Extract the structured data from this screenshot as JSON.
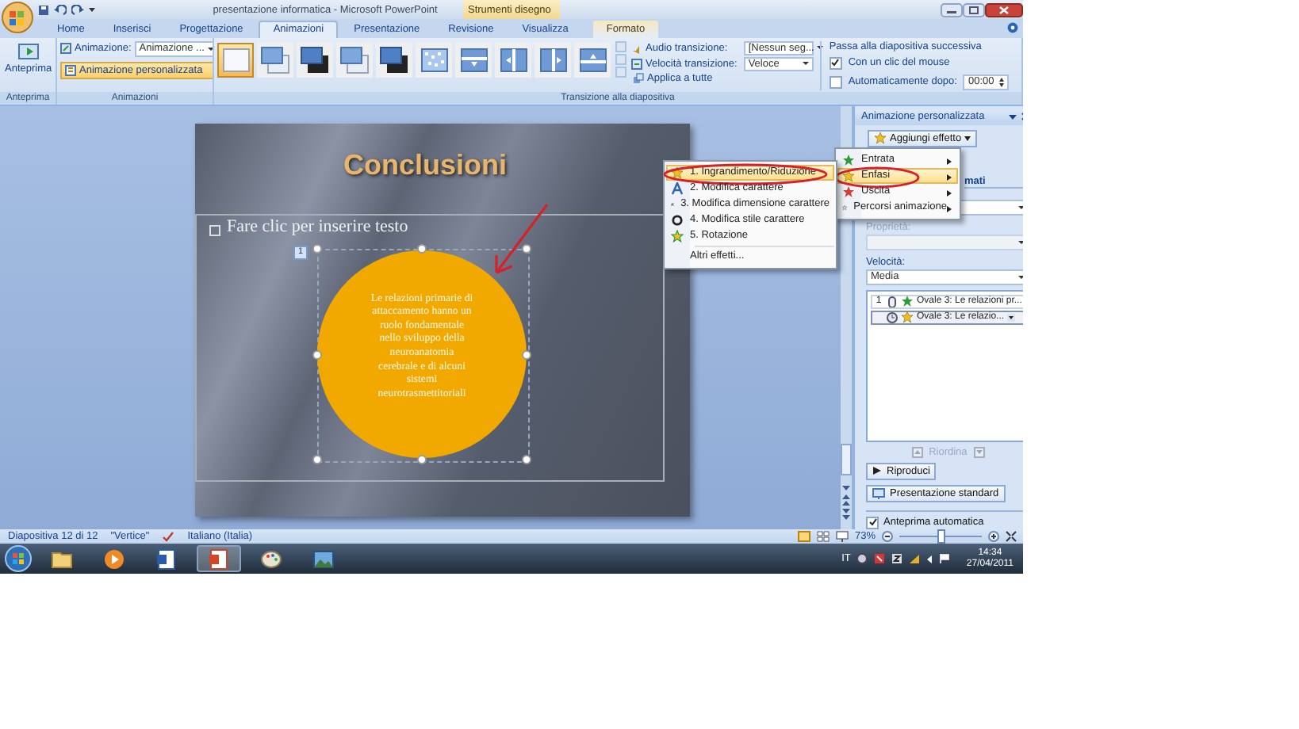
{
  "window": {
    "title": "presentazione informatica - Microsoft PowerPoint",
    "context_group": "Strumenti disegno"
  },
  "tabs": [
    {
      "label": "Home",
      "selected": false,
      "kind": "normal"
    },
    {
      "label": "Inserisci",
      "selected": false,
      "kind": "normal"
    },
    {
      "label": "Progettazione",
      "selected": false,
      "kind": "normal"
    },
    {
      "label": "Animazioni",
      "selected": true,
      "kind": "normal"
    },
    {
      "label": "Presentazione",
      "selected": false,
      "kind": "normal"
    },
    {
      "label": "Revisione",
      "selected": false,
      "kind": "normal"
    },
    {
      "label": "Visualizza",
      "selected": false,
      "kind": "normal"
    },
    {
      "label": "Formato",
      "selected": false,
      "kind": "context"
    }
  ],
  "ribbon": {
    "preview": {
      "button": "Anteprima",
      "group_label": "Anteprima"
    },
    "animations": {
      "animation_label": "Animazione:",
      "animation_value": "Animazione ...",
      "custom_button": {
        "label": "Animazione personalizzata",
        "selected": true
      },
      "group_label": "Animazioni"
    },
    "transitions": {
      "thumbnails": [
        {
          "kind": "none",
          "selected": true
        },
        {
          "kind": "fade",
          "selected": false
        },
        {
          "kind": "dark",
          "selected": false
        },
        {
          "kind": "fade",
          "selected": false
        },
        {
          "kind": "dark",
          "selected": false
        },
        {
          "kind": "dissolve",
          "selected": false
        },
        {
          "kind": "down",
          "selected": false
        },
        {
          "kind": "left",
          "selected": false
        },
        {
          "kind": "right",
          "selected": false
        },
        {
          "kind": "up",
          "selected": false
        }
      ],
      "audio": {
        "label": "Audio transizione:",
        "value": "[Nessun seg..."
      },
      "speed": {
        "label": "Velocità transizione:",
        "value": "Veloce"
      },
      "apply_all": "Applica a tutte",
      "group_label": "Transizione alla diapositiva"
    },
    "advance": {
      "title": "Passa alla diapositiva successiva",
      "options": [
        {
          "label": "Con un clic del mouse",
          "checked": true
        },
        {
          "label": "Automaticamente dopo:",
          "checked": false,
          "value": "00:00"
        }
      ]
    }
  },
  "slide": {
    "title": "Conclusioni",
    "placeholder": "Fare clic per inserire testo",
    "shape": {
      "order_tag": "1",
      "lines": [
        "Le relazioni primarie di",
        "attaccamento hanno un",
        "ruolo fondamentale",
        "nello sviluppo della",
        "neuroanatomia",
        "cerebrale e di alcuni",
        "sistemi",
        "neurotrasmettitoriali"
      ]
    }
  },
  "menus": {
    "main": [
      {
        "label": "Entrata",
        "kind": "entrance",
        "selected": false
      },
      {
        "label": "Enfasi",
        "kind": "emphasis",
        "selected": true
      },
      {
        "label": "Uscita",
        "kind": "exit",
        "selected": false
      },
      {
        "label": "Percorsi animazione",
        "kind": "path",
        "selected": false
      }
    ],
    "submenu": [
      {
        "label": "1. Ingrandimento/Riduzione",
        "kind": "grow",
        "selected": true
      },
      {
        "label": "2. Modifica carattere",
        "kind": "font",
        "selected": false
      },
      {
        "label": "3. Modifica dimensione carattere",
        "kind": "size",
        "selected": false
      },
      {
        "label": "4. Modifica stile carattere",
        "kind": "style",
        "selected": false
      },
      {
        "label": "5. Rotazione",
        "kind": "spin",
        "selected": false
      },
      {
        "label": "Altri effetti...",
        "kind": "more",
        "selected": false
      }
    ]
  },
  "task_pane": {
    "title": "Animazione personalizzata",
    "add_button": "Aggiungi effetto",
    "partial_heading": "mati",
    "property_label": "Proprietà:",
    "speed_label": "Velocità:",
    "speed_value": "Media",
    "list": [
      {
        "order": "1",
        "kind": "click",
        "label": "Ovale 3: Le relazioni pr...",
        "selected": false
      },
      {
        "kind": "after",
        "label": "Ovale 3: Le relazio...",
        "selected": true
      }
    ],
    "reorder": "Riordina",
    "play": "Riproduci",
    "slideshow": "Presentazione standard",
    "autopreview": {
      "label": "Anteprima automatica",
      "checked": true
    }
  },
  "status_bar": {
    "slide": "Diapositiva 12 di 12",
    "theme": "\"Vertice\"",
    "language": "Italiano (Italia)",
    "zoom": "73%",
    "zoom_slider": {
      "level": 0.5
    }
  },
  "taskbar": {
    "apps": [
      {
        "kind": "folder",
        "selected": false
      },
      {
        "kind": "media",
        "selected": false
      },
      {
        "kind": "word",
        "selected": false
      },
      {
        "kind": "powerpoint",
        "selected": true
      },
      {
        "kind": "paint",
        "selected": false
      },
      {
        "kind": "photo",
        "selected": false
      }
    ],
    "language": "IT",
    "time": "14:34",
    "date": "27/04/2011"
  }
}
